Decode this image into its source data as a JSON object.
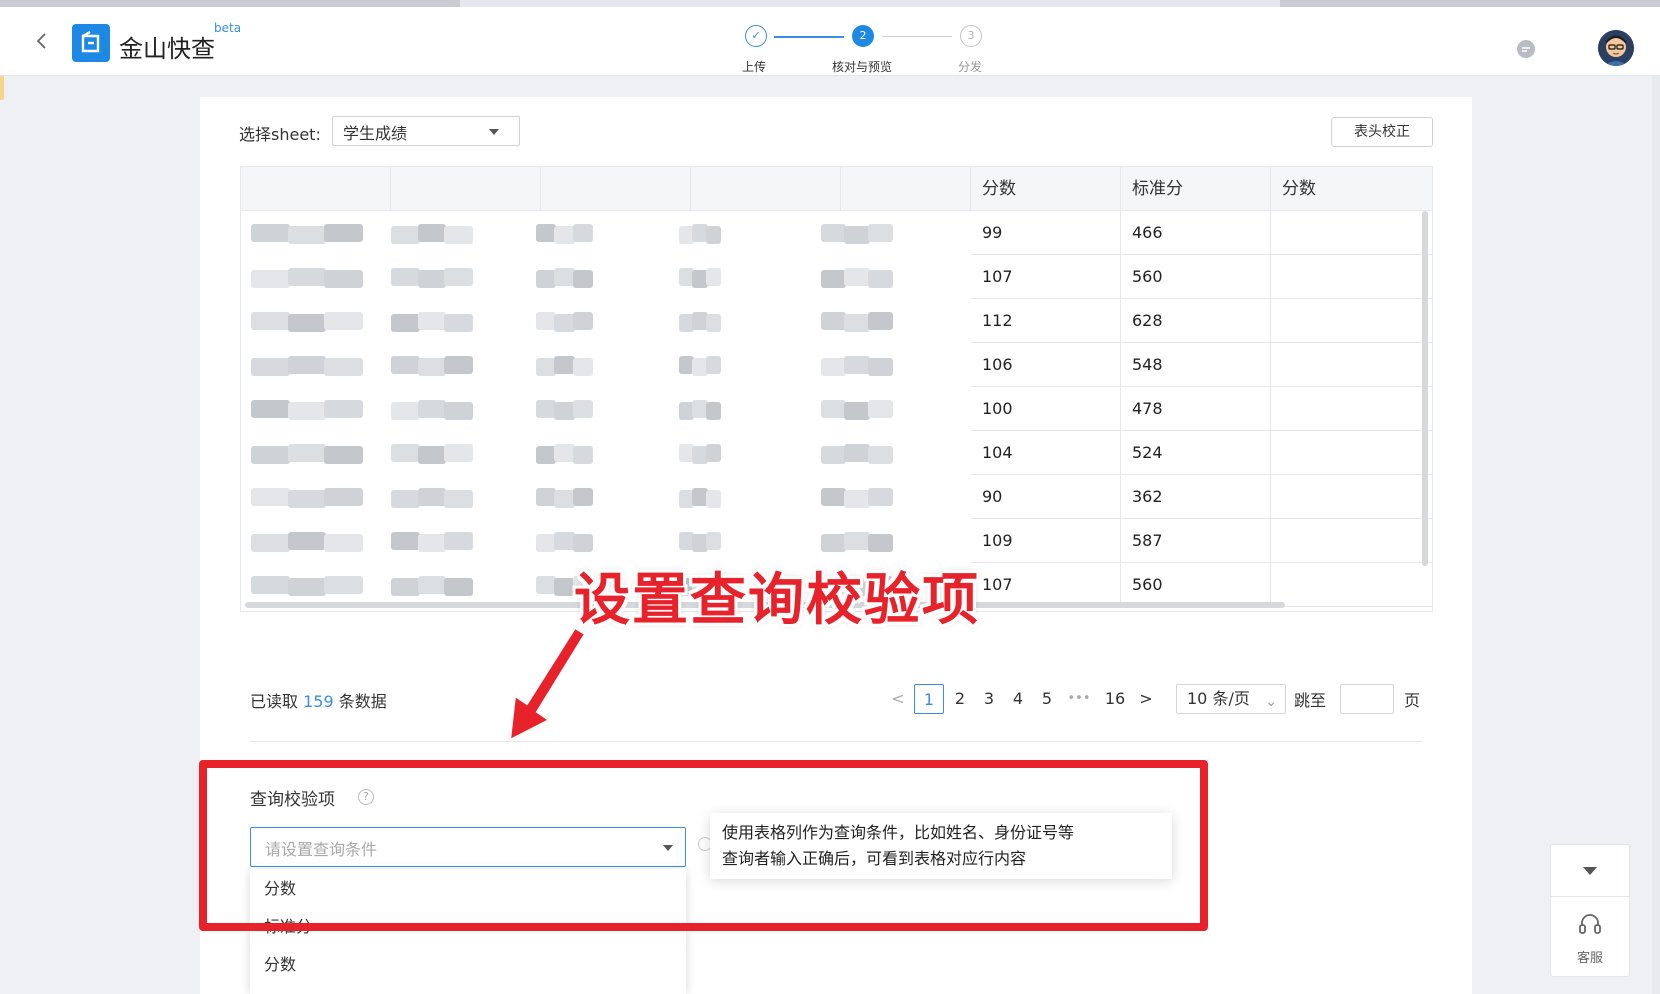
{
  "header": {
    "app_title": "金山快查",
    "beta_tag": "beta",
    "steps": [
      {
        "num": "✓",
        "label": "上传",
        "state": "done"
      },
      {
        "num": "2",
        "label": "核对与预览",
        "state": "active"
      },
      {
        "num": "3",
        "label": "分发",
        "state": "pending"
      }
    ],
    "icons": {
      "back": "chevron-left-icon",
      "logo": "app-logo-icon",
      "chat": "chat-bubble-icon",
      "avatar": "user-avatar"
    }
  },
  "sheet": {
    "label": "选择sheet:",
    "selected": "学生成绩",
    "head_fix_button": "表头校正"
  },
  "table": {
    "headers": [
      "",
      "",
      "",
      "",
      "",
      "分数",
      "标准分",
      "分数"
    ],
    "rows": [
      [
        "99",
        "466",
        ""
      ],
      [
        "107",
        "560",
        ""
      ],
      [
        "112",
        "628",
        ""
      ],
      [
        "106",
        "548",
        ""
      ],
      [
        "100",
        "478",
        ""
      ],
      [
        "104",
        "524",
        ""
      ],
      [
        "90",
        "362",
        ""
      ],
      [
        "109",
        "587",
        ""
      ],
      [
        "107",
        "560",
        ""
      ]
    ]
  },
  "pagination": {
    "read_prefix": "已读取",
    "read_count": "159",
    "read_suffix": "条数据",
    "prev": "<",
    "pages": [
      "1",
      "2",
      "3",
      "4",
      "5",
      "•••",
      "16"
    ],
    "next": ">",
    "page_size": "10 条/页",
    "jump_label": "跳至",
    "page_unit": "页"
  },
  "query": {
    "title": "查询校验项",
    "help": "?",
    "placeholder": "请设置查询条件",
    "options": [
      "分数",
      "标准分",
      "分数"
    ],
    "tooltip_line1": "使用表格列作为查询条件，比如姓名、身份证号等",
    "tooltip_line2": "查询者输入正确后，可看到表格对应行内容"
  },
  "annotation": {
    "text": "设置查询校验项",
    "color": "#e8222a"
  },
  "service_widget": {
    "label": "客服"
  },
  "colors": {
    "accent": "#1e88e5",
    "link": "#3a8ee6",
    "annotation_red": "#e8222a"
  }
}
